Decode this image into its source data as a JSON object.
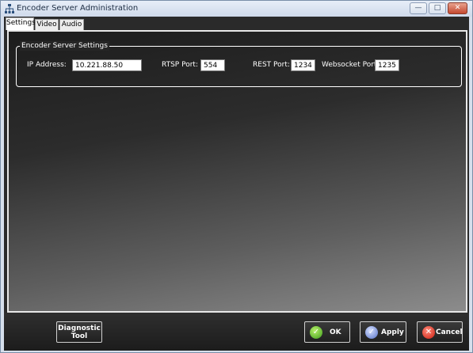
{
  "window": {
    "title": "Encoder Server Administration"
  },
  "tabs": [
    {
      "label": "Settings"
    },
    {
      "label": "Video"
    },
    {
      "label": "Audio"
    }
  ],
  "group": {
    "legend": "Encoder Server Settings",
    "ip_label": "IP Address:",
    "ip_value": "10.221.88.50",
    "rtsp_label": "RTSP Port:",
    "rtsp_value": "554",
    "rest_label": "REST Port:",
    "rest_value": "1234",
    "ws_label": "Websocket Port:",
    "ws_value": "1235"
  },
  "buttons": {
    "diagnostic": "Diagnostic\nTool",
    "ok": "OK",
    "apply": "Apply",
    "cancel": "Cancel"
  },
  "icons": {
    "app": "network-icon",
    "minimize": "minimize-icon",
    "maximize": "maximize-icon",
    "close": "close-icon",
    "ok": "check-icon",
    "apply": "apply-icon",
    "cancel": "cancel-icon"
  }
}
